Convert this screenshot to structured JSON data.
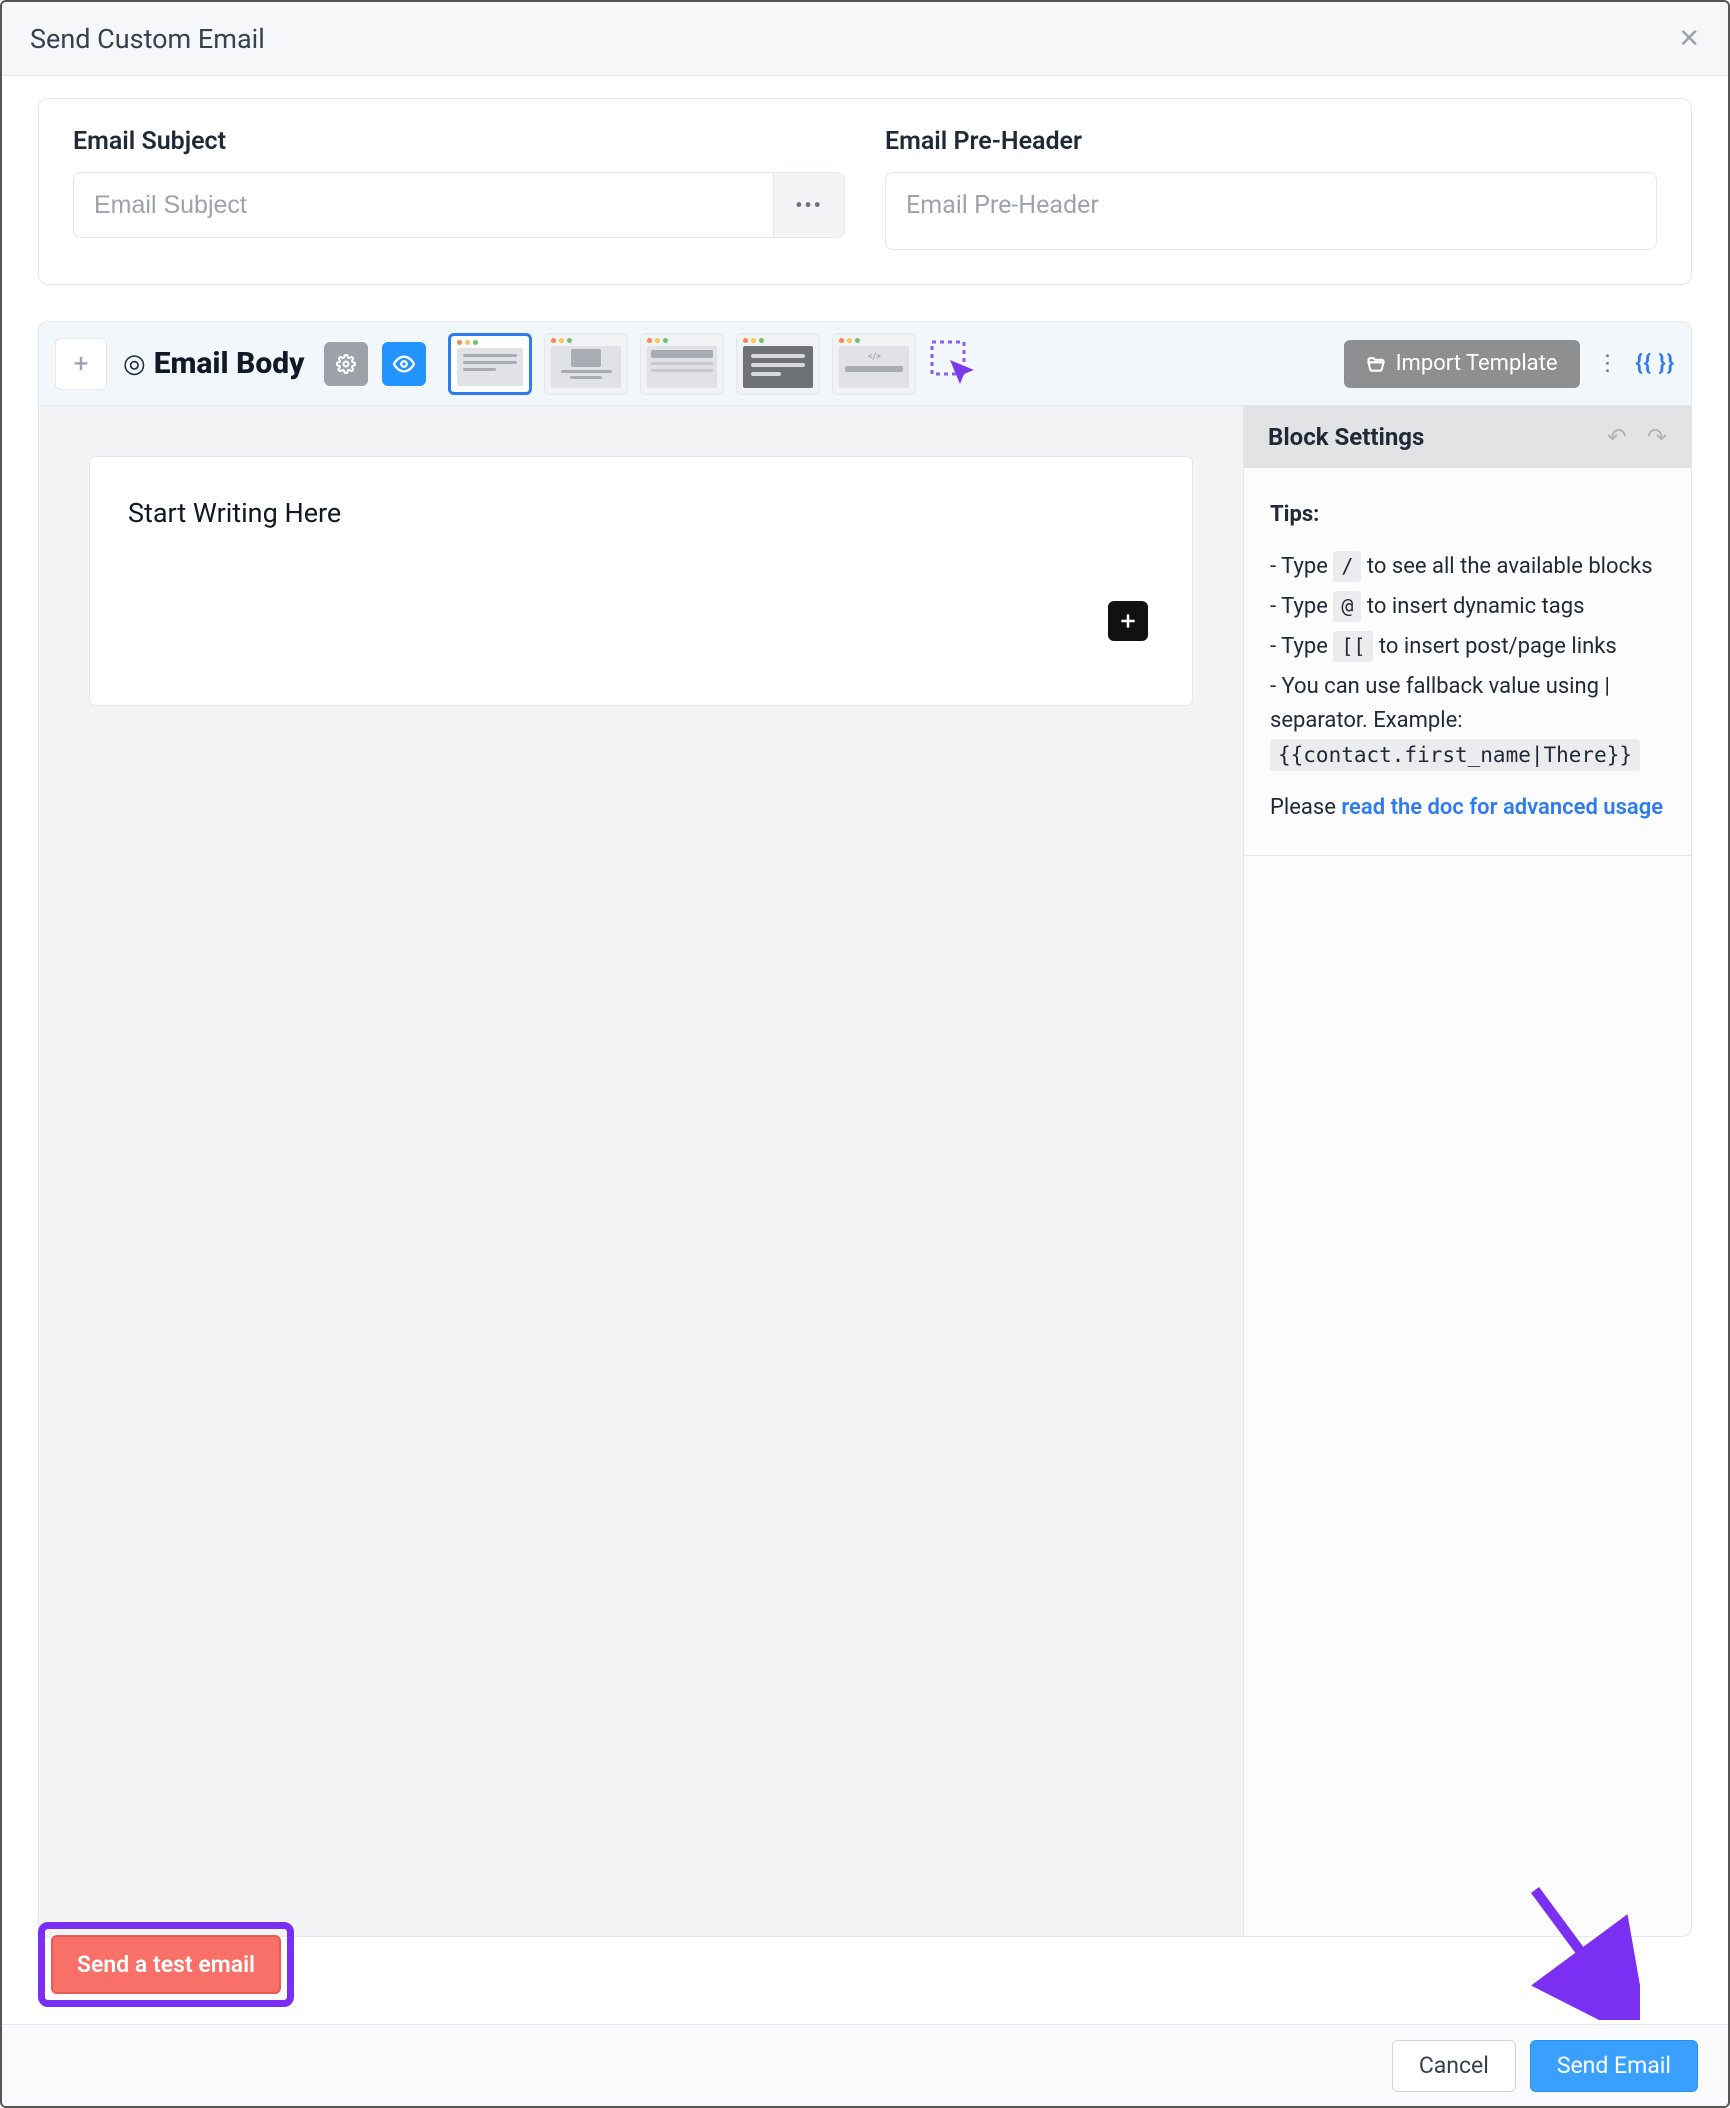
{
  "dialog": {
    "title": "Send Custom Email"
  },
  "fields": {
    "subject": {
      "label": "Email Subject",
      "placeholder": "Email Subject",
      "value": ""
    },
    "preheader": {
      "label": "Email Pre-Header",
      "placeholder": "Email Pre-Header",
      "value": ""
    }
  },
  "toolbar": {
    "body_label": "Email Body",
    "import_label": "Import Template",
    "brace_token": "{{ }}"
  },
  "canvas": {
    "start_text": "Start Writing Here"
  },
  "sidebar": {
    "title": "Block Settings",
    "tips_title": "Tips:",
    "tip1_prefix": "- Type ",
    "tip1_chip": "/",
    "tip1_suffix": " to see all the available blocks",
    "tip2_prefix": "- Type ",
    "tip2_chip": "@",
    "tip2_suffix": " to insert dynamic tags",
    "tip3_prefix": "- Type ",
    "tip3_chip": "[[",
    "tip3_suffix": " to insert post/page links",
    "tip4": "- You can use fallback value using | separator. Example: ",
    "tip4_code": "{{contact.first_name|There}}",
    "please": "Please ",
    "doc_link": "read the doc for advanced usage"
  },
  "buttons": {
    "test": "Send a test email",
    "cancel": "Cancel",
    "send": "Send Email"
  }
}
